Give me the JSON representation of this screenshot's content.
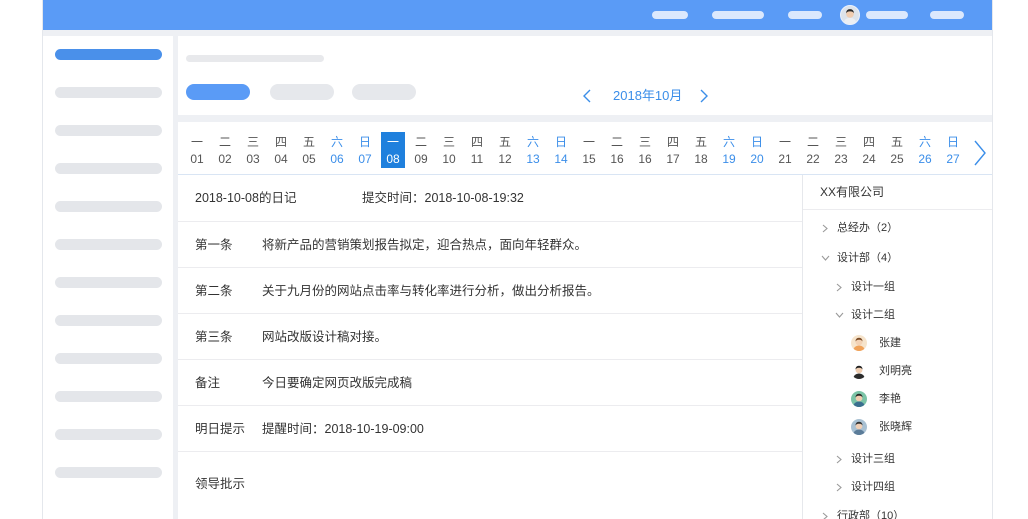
{
  "colors": {
    "brand_blue": "#5a9bf6",
    "accent_blue": "#3b8ee9",
    "selected_date": "#1f80dd"
  },
  "icons": {
    "prev_month": "chevron-left-icon",
    "next_month": "chevron-right-icon",
    "next_dates": "chevron-right-icon",
    "collapsed_node": "chevron-right-icon",
    "expanded_node": "chevron-down-icon"
  },
  "calendar": {
    "month_label": "2018年10月",
    "days": [
      {
        "weekday": "一",
        "date": "01"
      },
      {
        "weekday": "二",
        "date": "02"
      },
      {
        "weekday": "三",
        "date": "03"
      },
      {
        "weekday": "四",
        "date": "04"
      },
      {
        "weekday": "五",
        "date": "05"
      },
      {
        "weekday": "六",
        "date": "06",
        "weekend": true
      },
      {
        "weekday": "日",
        "date": "07",
        "weekend": true
      },
      {
        "weekday": "一",
        "date": "08",
        "selected": true
      },
      {
        "weekday": "二",
        "date": "09"
      },
      {
        "weekday": "三",
        "date": "10"
      },
      {
        "weekday": "四",
        "date": "11"
      },
      {
        "weekday": "五",
        "date": "12"
      },
      {
        "weekday": "六",
        "date": "13",
        "weekend": true
      },
      {
        "weekday": "日",
        "date": "14",
        "weekend": true
      },
      {
        "weekday": "一",
        "date": "15"
      },
      {
        "weekday": "二",
        "date": "16"
      },
      {
        "weekday": "三",
        "date": "16"
      },
      {
        "weekday": "四",
        "date": "17"
      },
      {
        "weekday": "五",
        "date": "18"
      },
      {
        "weekday": "六",
        "date": "19",
        "weekend": true
      },
      {
        "weekday": "日",
        "date": "20",
        "weekend": true
      },
      {
        "weekday": "一",
        "date": "21"
      },
      {
        "weekday": "二",
        "date": "22"
      },
      {
        "weekday": "三",
        "date": "23"
      },
      {
        "weekday": "四",
        "date": "24"
      },
      {
        "weekday": "五",
        "date": "25"
      },
      {
        "weekday": "六",
        "date": "26",
        "weekend": true
      },
      {
        "weekday": "日",
        "date": "27",
        "weekend": true
      }
    ]
  },
  "diary": {
    "title": "2018-10-08的日记",
    "submit_time": "提交时间：2018-10-08-19:32",
    "rows": [
      {
        "label": "第一条",
        "value": "将新产品的营销策划报告拟定，迎合热点，面向年轻群众。"
      },
      {
        "label": "第二条",
        "value": "关于九月份的网站点击率与转化率进行分析，做出分析报告。"
      },
      {
        "label": "第三条",
        "value": "网站改版设计稿对接。"
      },
      {
        "label": "备注",
        "value": "今日要确定网页改版完成稿"
      },
      {
        "label": "明日提示",
        "value": "提醒时间：2018-10-19-09:00"
      },
      {
        "label": "领导批示"
      }
    ]
  },
  "org": {
    "company": "XX有限公司",
    "departments": [
      {
        "name": "总经办（2）",
        "expanded": false
      },
      {
        "name": "设计部（4）",
        "expanded": true,
        "groups": [
          {
            "name": "设计一组",
            "expanded": false
          },
          {
            "name": "设计二组",
            "expanded": true,
            "members": [
              "张建",
              "刘明亮",
              "李艳",
              "张晓辉"
            ]
          },
          {
            "name": "设计三组",
            "expanded": false
          },
          {
            "name": "设计四组",
            "expanded": false
          }
        ]
      },
      {
        "name": "行政部（10）",
        "expanded": false
      }
    ]
  }
}
